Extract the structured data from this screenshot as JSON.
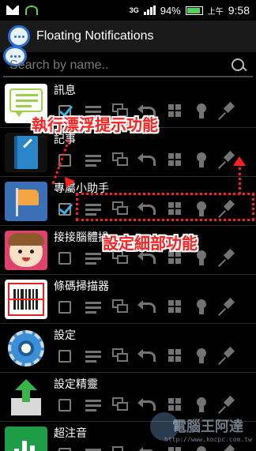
{
  "status_bar": {
    "network": "3G",
    "battery": "94%",
    "ampm": "上午",
    "time": "9:58"
  },
  "app": {
    "title": "Floating Notifications"
  },
  "search": {
    "placeholder": "Search by name.."
  },
  "apps": [
    {
      "name": "訊息",
      "checked": true
    },
    {
      "name": "記事",
      "checked": false
    },
    {
      "name": "專屬小助手",
      "checked": true
    },
    {
      "name": "接接腦體操",
      "checked": false
    },
    {
      "name": "條碼掃描器",
      "checked": false
    },
    {
      "name": "設定",
      "checked": false
    },
    {
      "name": "設定精靈",
      "checked": false
    },
    {
      "name": "超注音",
      "checked": false
    }
  ],
  "annotations": {
    "callout_top": "執行漂浮提示功能",
    "callout_bottom": "設定細部功能",
    "accent_color": "#ff2020"
  },
  "watermark": {
    "brand": "電腦王阿達",
    "url": "http://www.kocpc.com.tw"
  },
  "colors": {
    "checkbox_accent": "#33b5e5",
    "background": "#000000"
  }
}
